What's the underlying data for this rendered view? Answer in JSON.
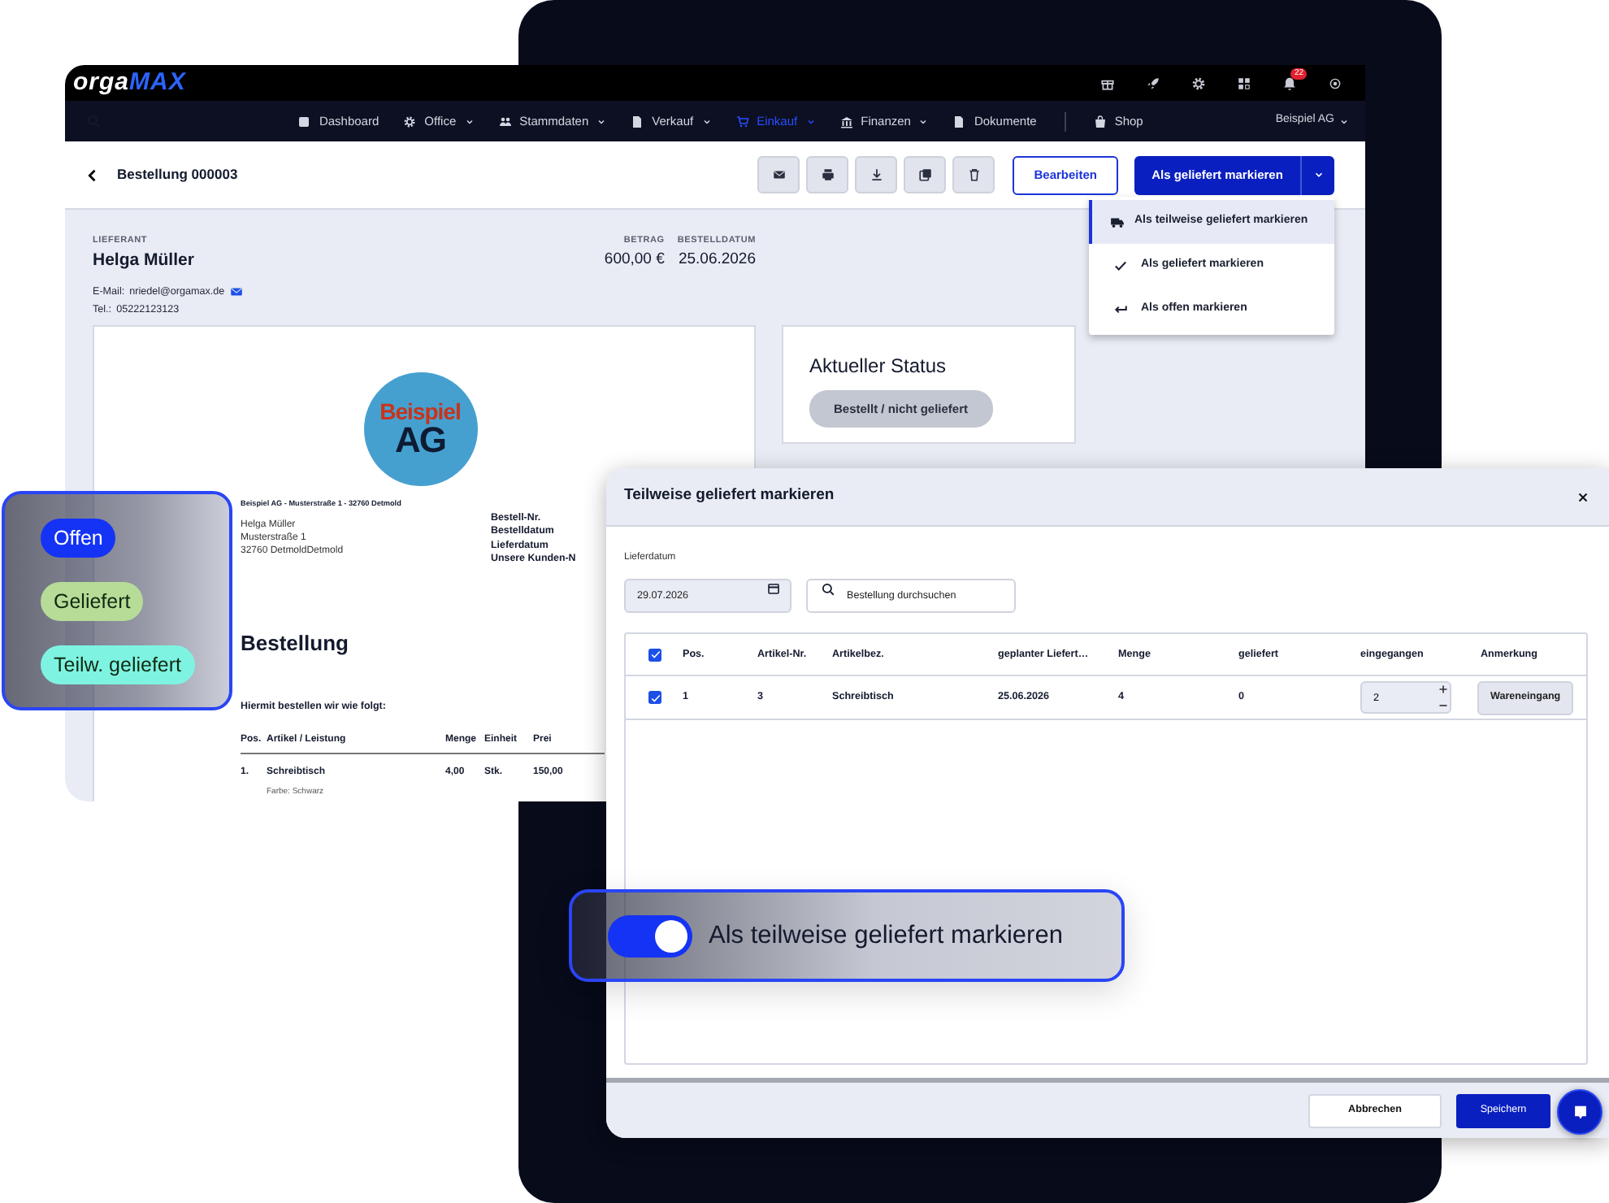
{
  "app": {
    "logo": {
      "part_1": "orga",
      "part_2": "MAX"
    },
    "notification_count": "22",
    "nav": [
      {
        "label": "Dashboard",
        "has_dropdown": false,
        "selected": false
      },
      {
        "label": "Office",
        "has_dropdown": true,
        "selected": false
      },
      {
        "label": "Stammdaten",
        "has_dropdown": true,
        "selected": false
      },
      {
        "label": "Verkauf",
        "has_dropdown": true,
        "selected": false
      },
      {
        "label": "Einkauf",
        "has_dropdown": true,
        "selected": true
      },
      {
        "label": "Finanzen",
        "has_dropdown": true,
        "selected": false
      },
      {
        "label": "Dokumente",
        "has_dropdown": false,
        "selected": false
      },
      {
        "label": "Shop",
        "has_dropdown": false,
        "selected": false
      }
    ],
    "account": "Beispiel AG",
    "header": {
      "title": "Bestellung 000003",
      "edit_button": "Bearbeiten",
      "primary_button": "Als geliefert markieren"
    },
    "status_menu": [
      {
        "label": "Als teilweise geliefert markieren",
        "kind": "partial",
        "selected": true
      },
      {
        "label": "Als geliefert markieren",
        "kind": "delivered",
        "selected": false
      },
      {
        "label": "Als offen markieren",
        "kind": "open",
        "selected": false
      }
    ],
    "supplier": {
      "label": "LIEFERANT",
      "name": "Helga Müller",
      "email_label": "E-Mail:",
      "email": "nriedel@orgamax.de",
      "phone_label": "Tel.:",
      "phone": "05222123123"
    },
    "summary": [
      {
        "label": "BETRAG",
        "value": "600,00 €"
      },
      {
        "label": "BESTELLDATUM",
        "value": "25.06.2026"
      }
    ],
    "status_card": {
      "title": "Aktueller Status",
      "status": "Bestellt / nicht geliefert"
    },
    "document": {
      "logo": {
        "line_1": "Beispiel",
        "line_2": "AG"
      },
      "sender_line": "Beispiel AG - Musterstraße 1 - 32760 Detmold",
      "address": [
        "Helga Müller",
        "Musterstraße 1",
        "32760 DetmoldDetmold"
      ],
      "meta_labels": [
        "Bestell-Nr.",
        "Bestelldatum",
        "Lieferdatum",
        "Unsere Kunden-N"
      ],
      "heading": "Bestellung",
      "intro": "Hiermit bestellen wir wie folgt:",
      "table": {
        "columns": [
          "Pos.",
          "Artikel / Leistung",
          "Menge",
          "Einheit",
          "Prei"
        ],
        "rows": [
          {
            "cells": [
              "1.",
              "Schreibtisch",
              "4,00",
              "Stk.",
              "150,00"
            ],
            "note": "Farbe: Schwarz"
          }
        ]
      }
    }
  },
  "status_badges": [
    {
      "label": "Offen",
      "color": "#1433f5"
    },
    {
      "label": "Geliefert",
      "color": "#b6dc98"
    },
    {
      "label": "Teilw. geliefert",
      "color": "#7ff3e2"
    }
  ],
  "dialog": {
    "title": "Teilweise geliefert markieren",
    "date_label": "Lieferdatum",
    "date_value": "29.07.2026",
    "search_placeholder": "Bestellung durchsuchen",
    "table": {
      "all_checked": true,
      "columns": [
        "Pos.",
        "Artikel-Nr.",
        "Artikelbez.",
        "geplanter Liefert…",
        "Menge",
        "geliefert",
        "eingegangen",
        "Anmerkung"
      ],
      "rows": [
        {
          "checked": true,
          "cells": [
            "1",
            "3",
            "Schreibtisch",
            "25.06.2026",
            "4",
            "0"
          ],
          "received": "2",
          "note_button": "Wareneingang"
        }
      ]
    },
    "cancel_button": "Abbrechen",
    "save_button": "Speichern"
  },
  "toggle_callout": {
    "label": "Als teilweise geliefert markieren",
    "on": true
  }
}
